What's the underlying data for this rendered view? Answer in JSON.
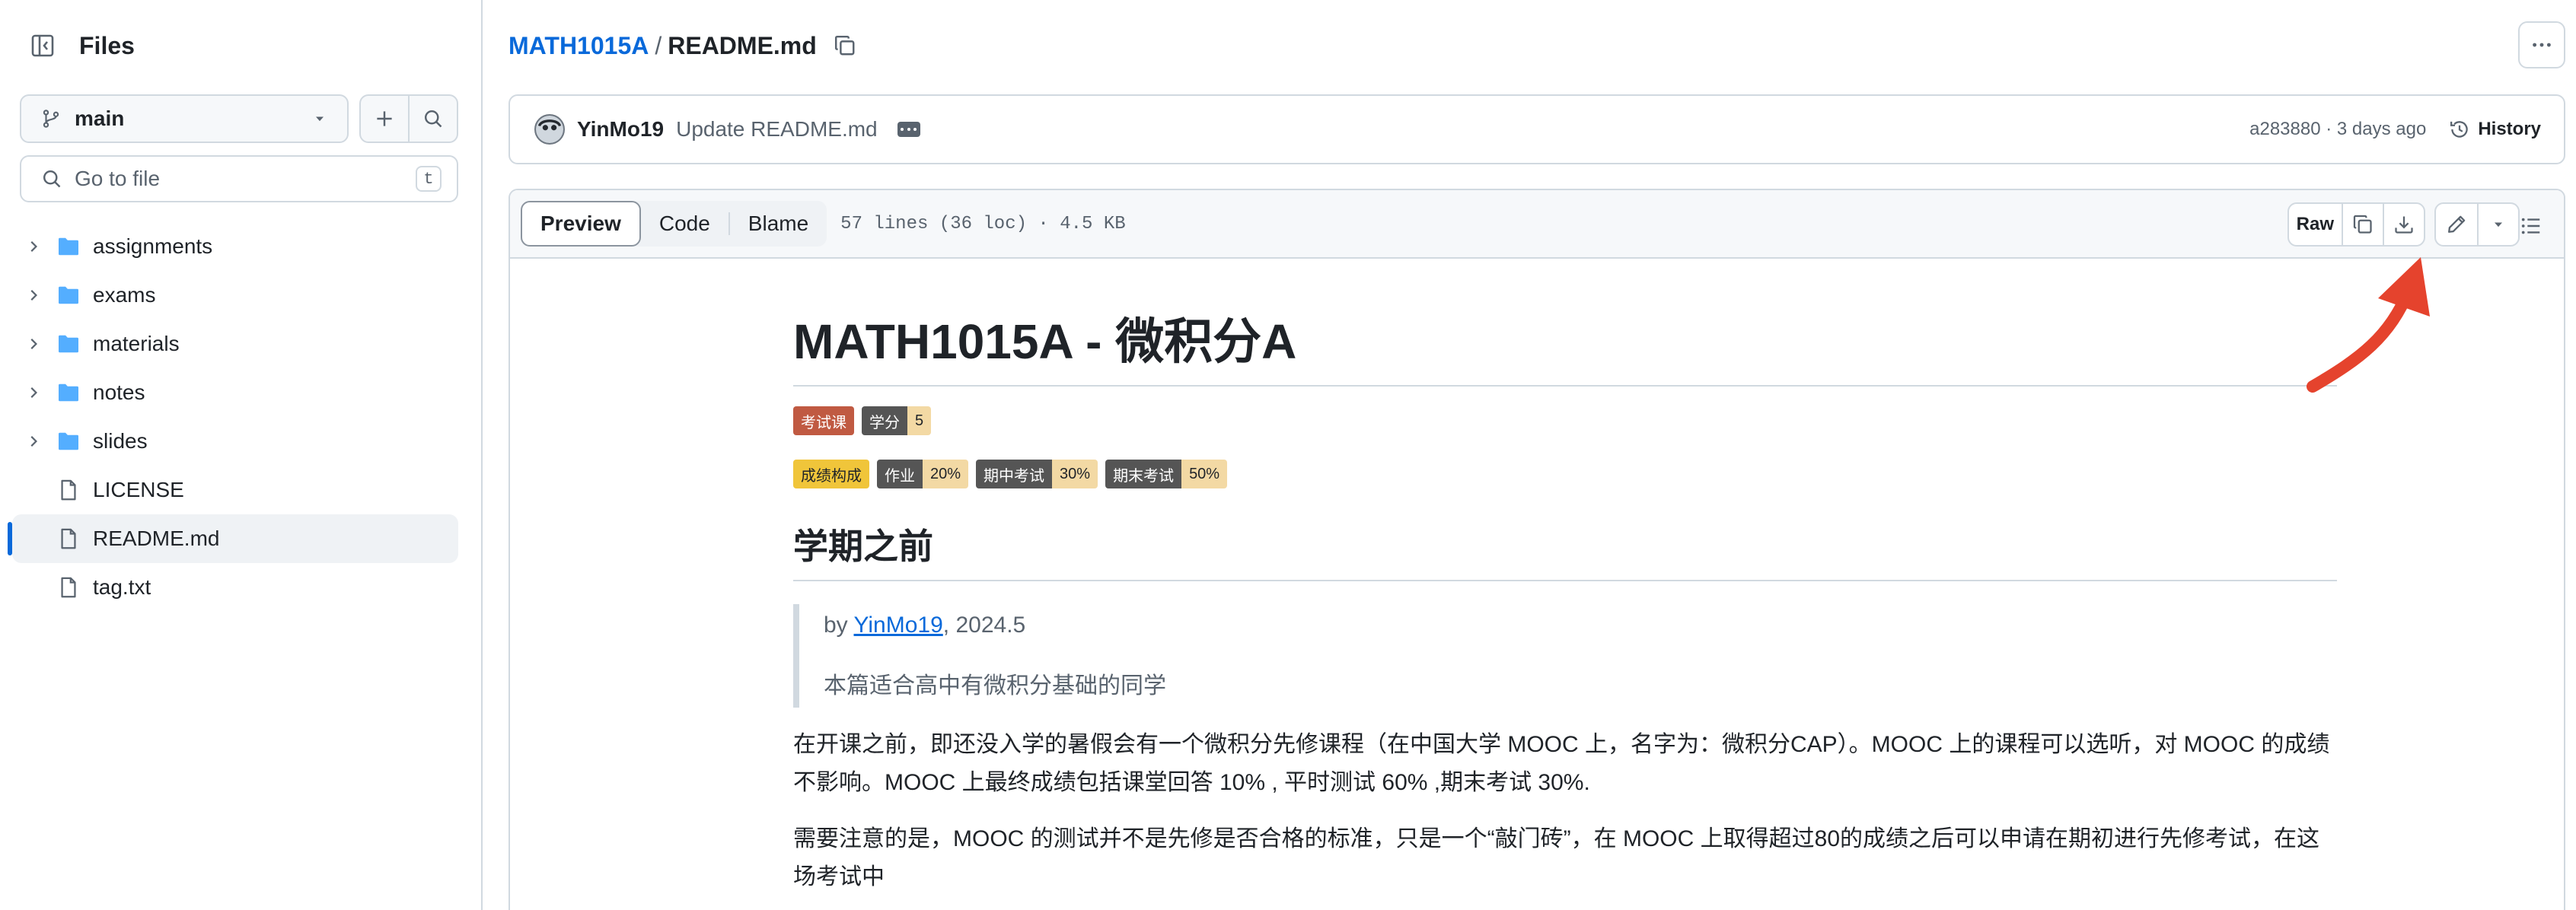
{
  "sidebar": {
    "title": "Files",
    "branch": "main",
    "goto_placeholder": "Go to file",
    "goto_shortcut": "t",
    "items": [
      {
        "label": "assignments",
        "type": "folder"
      },
      {
        "label": "exams",
        "type": "folder"
      },
      {
        "label": "materials",
        "type": "folder"
      },
      {
        "label": "notes",
        "type": "folder"
      },
      {
        "label": "slides",
        "type": "folder"
      },
      {
        "label": "LICENSE",
        "type": "file"
      },
      {
        "label": "README.md",
        "type": "file",
        "active": true
      },
      {
        "label": "tag.txt",
        "type": "file"
      }
    ]
  },
  "breadcrumb": {
    "repo": "MATH1015A",
    "separator": "/",
    "file": "README.md"
  },
  "commit": {
    "author": "YinMo19",
    "message": "Update README.md",
    "meta": "a283880 · 3 days ago",
    "history_label": "History"
  },
  "fileview": {
    "tabs": [
      "Preview",
      "Code",
      "Blame"
    ],
    "active_tab": "Preview",
    "info": "57 lines (36 loc) · 4.5 KB",
    "raw_label": "Raw"
  },
  "readme": {
    "title": "MATH1015A - 微积分A",
    "badges_row1": [
      {
        "label": "考试课",
        "value": "",
        "label_color": "#c05a42"
      },
      {
        "label": "学分",
        "value": "5",
        "label_color": "#555555",
        "value_color": "#f3d9a4"
      }
    ],
    "badges_row2": [
      {
        "label": "成绩构成",
        "value": "",
        "label_color": "#f0c53a"
      },
      {
        "label": "作业",
        "value": "20%",
        "label_color": "#555555",
        "value_color": "#f3d9a4"
      },
      {
        "label": "期中考试",
        "value": "30%",
        "label_color": "#555555",
        "value_color": "#f3d9a4"
      },
      {
        "label": "期末考试",
        "value": "50%",
        "label_color": "#555555",
        "value_color": "#f3d9a4"
      }
    ],
    "h2": "学期之前",
    "quote_by": "by ",
    "quote_author": "YinMo19",
    "quote_date": ", 2024.5",
    "quote_note": "本篇适合高中有微积分基础的同学",
    "para1": "在开课之前，即还没入学的暑假会有一个微积分先修课程（在中国大学 MOOC 上，名字为：微积分CAP）。MOOC 上的课程可以选听，对 MOOC 的成绩不影响。MOOC 上最终成绩包括课堂回答 10% , 平时测试 60% ,期末考试 30%.",
    "para2": "需要注意的是，MOOC 的测试并不是先修是否合格的标准，只是一个“敲门砖”，在 MOOC 上取得超过80的成绩之后可以申请在期初进行先修考试，在这场考试中"
  },
  "colors": {
    "accent": "#0969da",
    "folder": "#54aeff",
    "annotation_arrow": "#e5432d"
  }
}
